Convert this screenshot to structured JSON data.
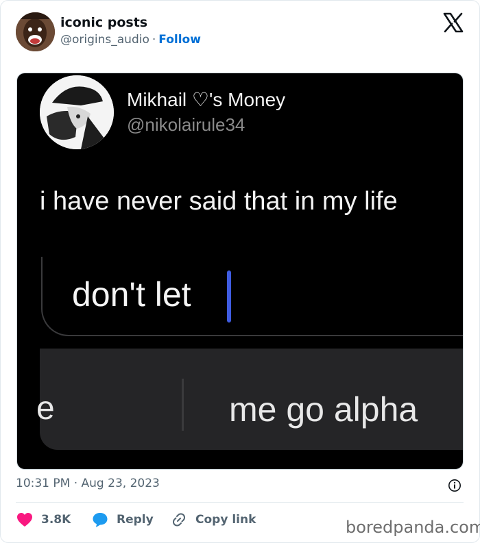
{
  "header": {
    "author_name": "iconic posts",
    "author_handle": "@origins_audio",
    "separator": "·",
    "follow_label": "Follow"
  },
  "media": {
    "profile_name": "Mikhail ♡'s Money",
    "profile_handle": "@nikolairule34",
    "message_text": "i have never said that in my life",
    "input_text": "don't let",
    "suggestion_left": "e",
    "suggestion_right": "me go alpha"
  },
  "footer": {
    "timestamp": "10:31 PM · Aug 23, 2023",
    "likes_count": "3.8K",
    "reply_label": "Reply",
    "copy_link_label": "Copy link"
  },
  "watermark": "boredpanda.com",
  "colors": {
    "accent": "#006fd6",
    "like": "#f91880",
    "reply": "#1d9bf0",
    "caret": "#3f5ce0",
    "muted": "#536471"
  }
}
